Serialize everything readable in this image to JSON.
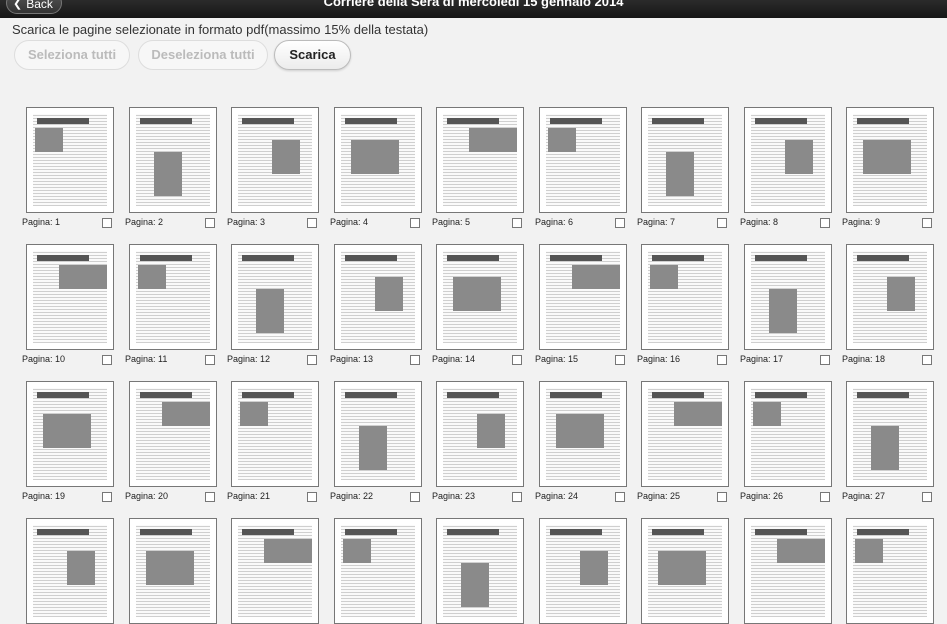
{
  "header": {
    "back_label": "Back",
    "title": "Corriere della Sera di mercoledì 15 gennaio 2014"
  },
  "instructions": "Scarica le pagine selezionate in formato pdf(massimo 15% della testata)",
  "buttons": {
    "select_all": "Seleziona tutti",
    "deselect_all": "Deseleziona tutti",
    "download": "Scarica"
  },
  "pages": [
    {
      "label": "Pagina: 1"
    },
    {
      "label": "Pagina: 2"
    },
    {
      "label": "Pagina: 3"
    },
    {
      "label": "Pagina: 4"
    },
    {
      "label": "Pagina: 5"
    },
    {
      "label": "Pagina: 6"
    },
    {
      "label": "Pagina: 7"
    },
    {
      "label": "Pagina: 8"
    },
    {
      "label": "Pagina: 9"
    },
    {
      "label": "Pagina: 10"
    },
    {
      "label": "Pagina: 11"
    },
    {
      "label": "Pagina: 12"
    },
    {
      "label": "Pagina: 13"
    },
    {
      "label": "Pagina: 14"
    },
    {
      "label": "Pagina: 15"
    },
    {
      "label": "Pagina: 16"
    },
    {
      "label": "Pagina: 17"
    },
    {
      "label": "Pagina: 18"
    },
    {
      "label": "Pagina: 19"
    },
    {
      "label": "Pagina: 20"
    },
    {
      "label": "Pagina: 21"
    },
    {
      "label": "Pagina: 22"
    },
    {
      "label": "Pagina: 23"
    },
    {
      "label": "Pagina: 24"
    },
    {
      "label": "Pagina: 25"
    },
    {
      "label": "Pagina: 26"
    },
    {
      "label": "Pagina: 27"
    },
    {
      "label": ""
    },
    {
      "label": ""
    },
    {
      "label": ""
    },
    {
      "label": ""
    },
    {
      "label": ""
    },
    {
      "label": ""
    },
    {
      "label": ""
    },
    {
      "label": ""
    },
    {
      "label": ""
    }
  ]
}
